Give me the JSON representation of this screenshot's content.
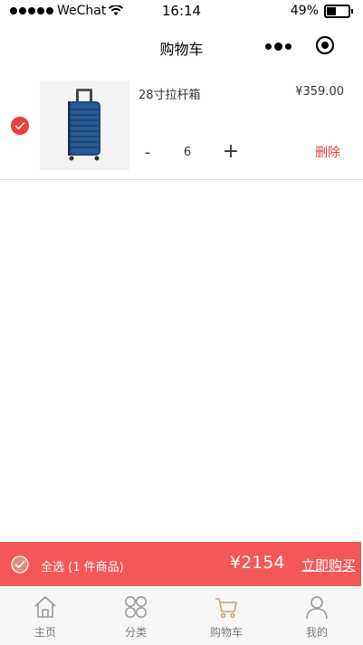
{
  "status_bar": {
    "carrier": "WeChat",
    "time": "16:14",
    "battery": "49%",
    "battery_level": 0.49
  },
  "nav": {
    "title": "购物车"
  },
  "cart": {
    "items": [
      {
        "name": "28寸拉杆箱",
        "price": "¥359.00",
        "quantity": "6",
        "minus": "-",
        "plus": "+",
        "delete": "删除",
        "checked": true
      }
    ]
  },
  "checkout": {
    "select_all": "全选 (1 件商品)",
    "total": "¥2154",
    "buy": "立即购买"
  },
  "tabs": [
    {
      "label": "主页",
      "icon": "home-icon"
    },
    {
      "label": "分类",
      "icon": "category-icon"
    },
    {
      "label": "购物车",
      "icon": "cart-icon"
    },
    {
      "label": "我的",
      "icon": "user-icon"
    }
  ],
  "colors": {
    "accent": "#f45757",
    "check_red": "#e8403e",
    "cart_tab_active": "#c8a27a",
    "tab_inactive": "#9a9a9a"
  }
}
